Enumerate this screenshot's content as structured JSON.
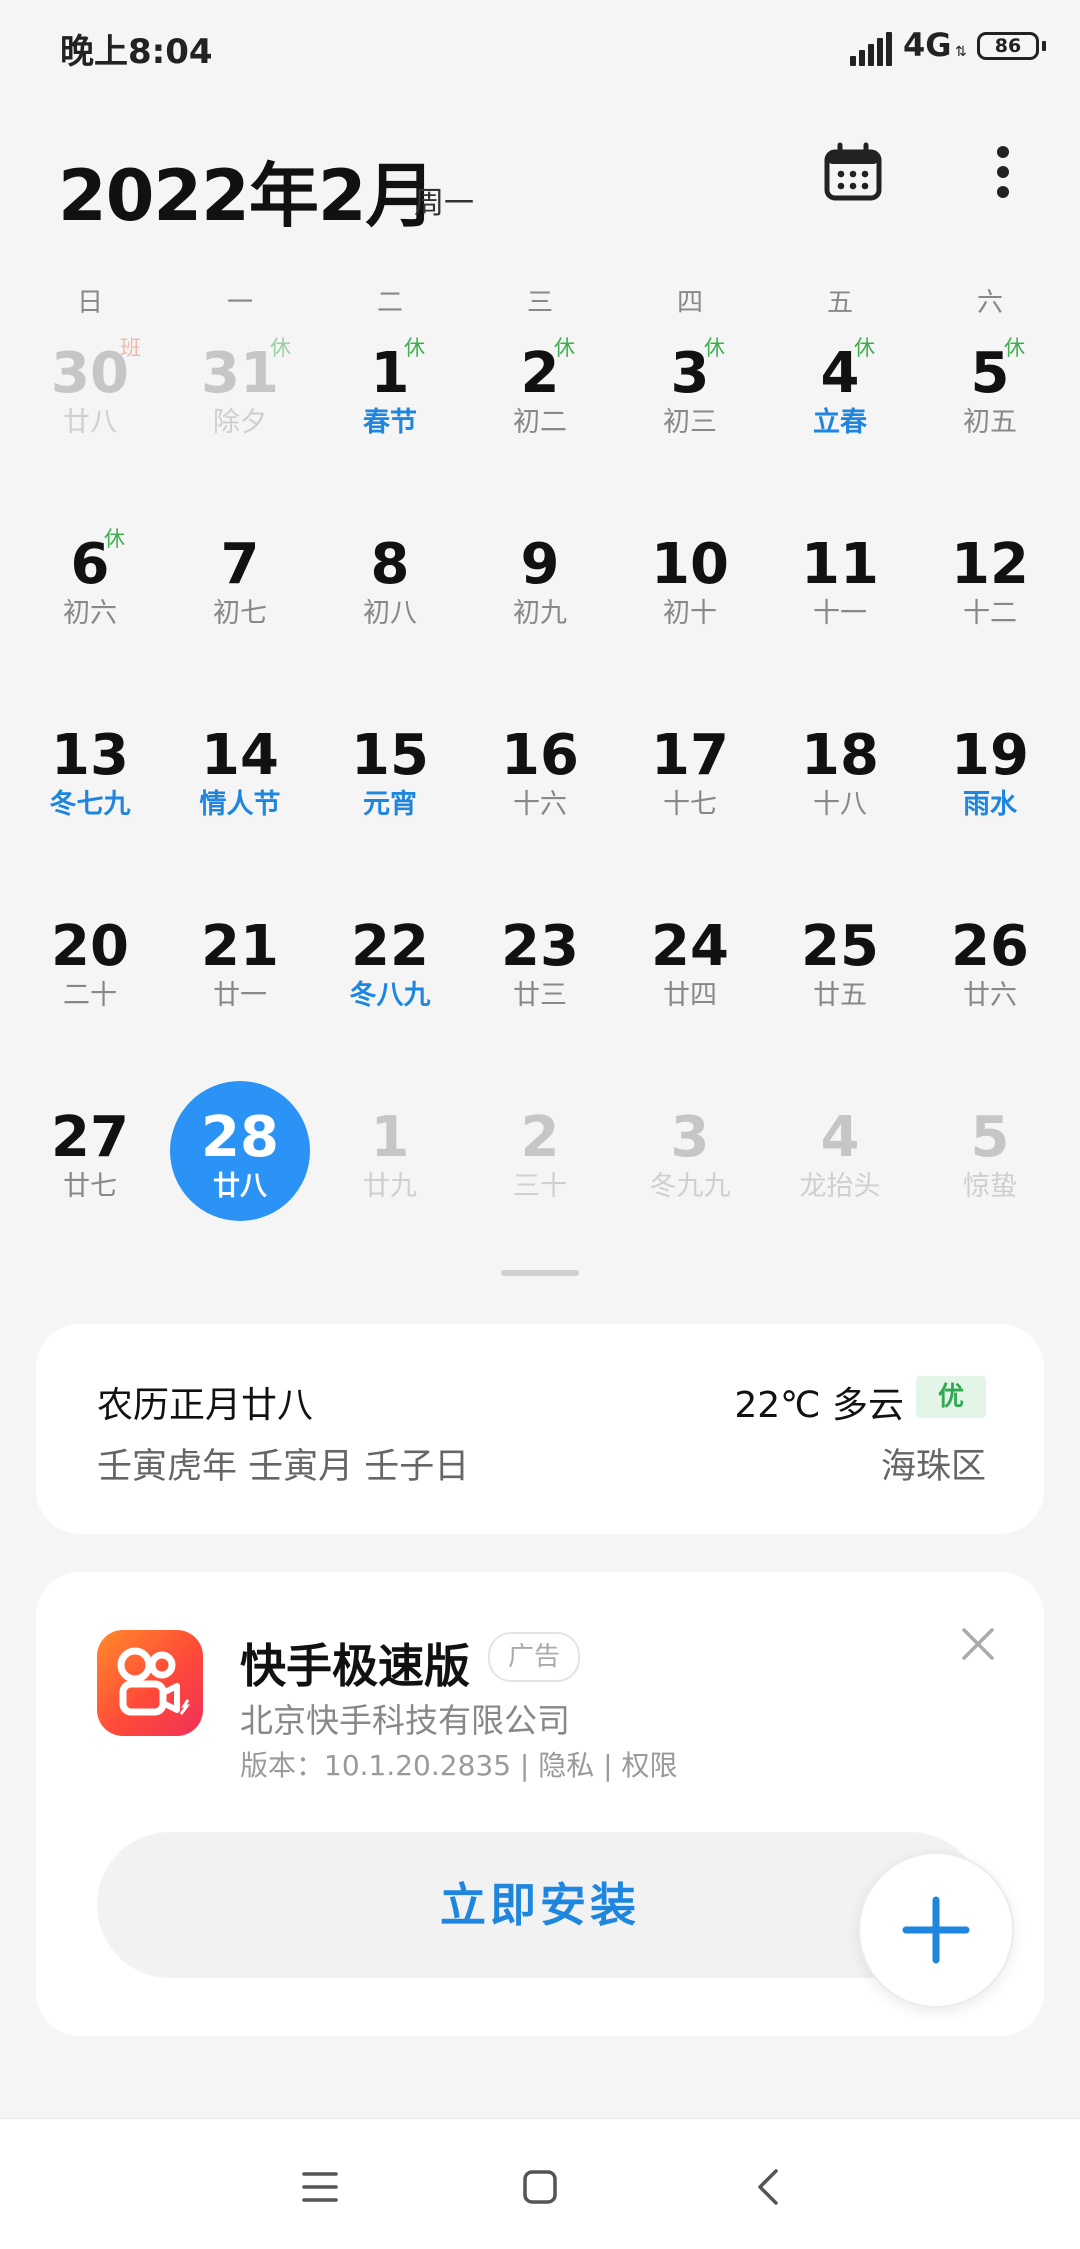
{
  "status": {
    "time": "晚上8:04",
    "network": "4G",
    "network_arrows": "⇅",
    "battery": "86"
  },
  "header": {
    "month_title": "2022年2月",
    "weekday": "周一",
    "calendar_icon": "calendar-icon",
    "more_icon": "more-vert-icon"
  },
  "weekdays": [
    "日",
    "一",
    "二",
    "三",
    "四",
    "五",
    "六"
  ],
  "days": [
    {
      "num": "30",
      "sub": "廿八",
      "tag": "班",
      "tag_color": "#e8825f",
      "faded": true
    },
    {
      "num": "31",
      "sub": "除夕",
      "tag": "休",
      "tag_color": "#3fae4f",
      "faded": true
    },
    {
      "num": "1",
      "sub": "春节",
      "tag": "休",
      "tag_color": "#3fae4f",
      "blue": true
    },
    {
      "num": "2",
      "sub": "初二",
      "tag": "休",
      "tag_color": "#3fae4f"
    },
    {
      "num": "3",
      "sub": "初三",
      "tag": "休",
      "tag_color": "#3fae4f"
    },
    {
      "num": "4",
      "sub": "立春",
      "tag": "休",
      "tag_color": "#3fae4f",
      "blue": true
    },
    {
      "num": "5",
      "sub": "初五",
      "tag": "休",
      "tag_color": "#3fae4f"
    },
    {
      "num": "6",
      "sub": "初六",
      "tag": "休",
      "tag_color": "#3fae4f"
    },
    {
      "num": "7",
      "sub": "初七"
    },
    {
      "num": "8",
      "sub": "初八"
    },
    {
      "num": "9",
      "sub": "初九"
    },
    {
      "num": "10",
      "sub": "初十"
    },
    {
      "num": "11",
      "sub": "十一"
    },
    {
      "num": "12",
      "sub": "十二"
    },
    {
      "num": "13",
      "sub": "冬七九",
      "blue": true
    },
    {
      "num": "14",
      "sub": "情人节",
      "blue": true
    },
    {
      "num": "15",
      "sub": "元宵",
      "blue": true
    },
    {
      "num": "16",
      "sub": "十六"
    },
    {
      "num": "17",
      "sub": "十七"
    },
    {
      "num": "18",
      "sub": "十八"
    },
    {
      "num": "19",
      "sub": "雨水",
      "blue": true
    },
    {
      "num": "20",
      "sub": "二十"
    },
    {
      "num": "21",
      "sub": "廿一"
    },
    {
      "num": "22",
      "sub": "冬八九",
      "blue": true
    },
    {
      "num": "23",
      "sub": "廿三"
    },
    {
      "num": "24",
      "sub": "廿四"
    },
    {
      "num": "25",
      "sub": "廿五"
    },
    {
      "num": "26",
      "sub": "廿六"
    },
    {
      "num": "27",
      "sub": "廿七"
    },
    {
      "num": "28",
      "sub": "廿八",
      "selected": true
    },
    {
      "num": "1",
      "sub": "廿九",
      "faded": true
    },
    {
      "num": "2",
      "sub": "三十",
      "faded": true
    },
    {
      "num": "3",
      "sub": "冬九九",
      "faded": true
    },
    {
      "num": "4",
      "sub": "龙抬头",
      "faded": true
    },
    {
      "num": "5",
      "sub": "惊蛰",
      "faded": true
    }
  ],
  "info_card": {
    "lunar_date": "农历正月廿八",
    "ganzhi": "壬寅虎年 壬寅月 壬子日",
    "weather": "22℃ 多云",
    "aqi": "优",
    "district": "海珠区"
  },
  "ad_card": {
    "app_name": "快手极速版",
    "ad_badge": "广告",
    "company": "北京快手科技有限公司",
    "version_line": "版本：10.1.20.2835 | 隐私 | 权限",
    "install_label": "立即安装",
    "app_icon": "kuaishou-app-icon",
    "close_icon": "close-icon"
  },
  "fab": {
    "icon": "plus-icon",
    "color": "#1e86de"
  },
  "colors": {
    "accent_blue": "#1e86de",
    "selected_blue": "#2a93f5",
    "rest_green": "#3fae4f",
    "work_orange": "#e8825f"
  }
}
